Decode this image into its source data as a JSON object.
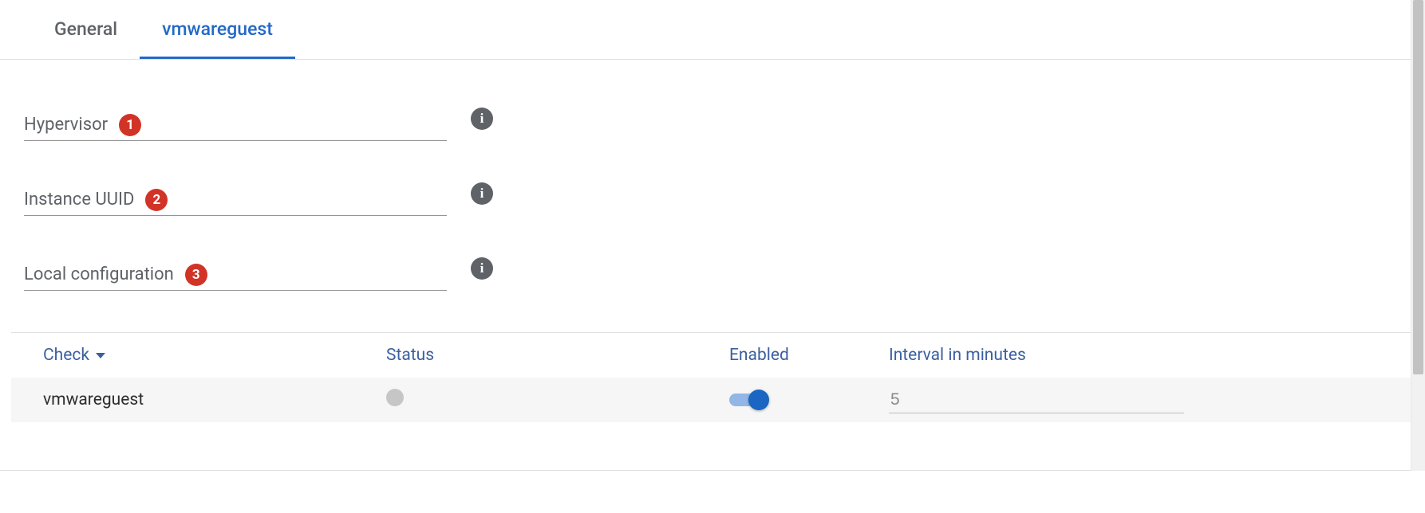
{
  "tabs": [
    {
      "label": "General",
      "active": false
    },
    {
      "label": "vmwareguest",
      "active": true
    }
  ],
  "fields": [
    {
      "label": "Hypervisor",
      "badge": "1",
      "value": "",
      "info": true
    },
    {
      "label": "Instance UUID",
      "badge": "2",
      "value": "",
      "info": true
    },
    {
      "label": "Local configuration",
      "badge": "3",
      "value": "",
      "info": true
    }
  ],
  "table": {
    "headers": {
      "check": "Check",
      "status": "Status",
      "enabled": "Enabled",
      "interval": "Interval in minutes"
    },
    "rows": [
      {
        "check": "vmwareguest",
        "status": "none",
        "enabled": true,
        "interval": "5"
      }
    ]
  },
  "info_glyph": "i"
}
